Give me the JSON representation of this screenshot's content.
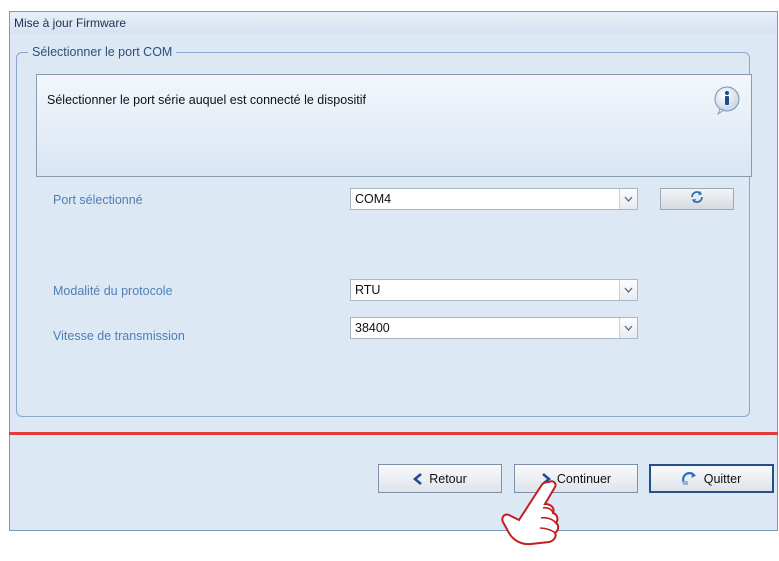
{
  "window": {
    "title": "Mise à jour Firmware"
  },
  "group": {
    "title": "Sélectionner le port COM"
  },
  "info": {
    "text": "Sélectionner le port série auquel est connecté le dispositif",
    "icon": "info-icon"
  },
  "fields": {
    "port": {
      "label": "Port sélectionné",
      "value": "COM4"
    },
    "protocol": {
      "label": "Modalité du protocole",
      "value": "RTU"
    },
    "speed": {
      "label": "Vitesse de transmission",
      "value": "38400"
    }
  },
  "buttons": {
    "back": "Retour",
    "continue": "Continuer",
    "quit": "Quitter"
  },
  "colors": {
    "accent": "#284f8c",
    "separator": "#e33b3b",
    "label": "#4f7fb3"
  }
}
